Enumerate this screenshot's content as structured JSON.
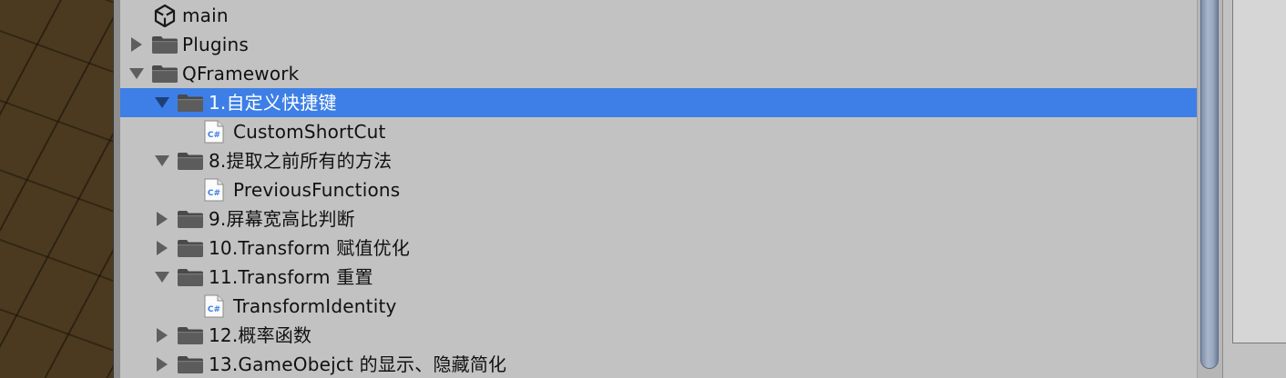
{
  "tree": {
    "items": [
      {
        "label": "main",
        "icon": "unity-scene-icon",
        "arrow": "none",
        "selected": false,
        "indent": 0
      },
      {
        "label": "Plugins",
        "icon": "folder-icon",
        "arrow": "collapsed",
        "selected": false,
        "indent": 0
      },
      {
        "label": "QFramework",
        "icon": "folder-icon",
        "arrow": "expanded",
        "selected": false,
        "indent": 0
      },
      {
        "label": "1.自定义快捷键",
        "icon": "folder-icon",
        "arrow": "expanded",
        "selected": true,
        "indent": 1
      },
      {
        "label": "CustomShortCut",
        "icon": "csharp-script-icon",
        "arrow": "none",
        "selected": false,
        "indent": 2
      },
      {
        "label": "8.提取之前所有的方法",
        "icon": "folder-icon",
        "arrow": "expanded",
        "selected": false,
        "indent": 1
      },
      {
        "label": "PreviousFunctions",
        "icon": "csharp-script-icon",
        "arrow": "none",
        "selected": false,
        "indent": 2
      },
      {
        "label": "9.屏幕宽高比判断",
        "icon": "folder-icon",
        "arrow": "collapsed",
        "selected": false,
        "indent": 1
      },
      {
        "label": "10.Transform 赋值优化",
        "icon": "folder-icon",
        "arrow": "collapsed",
        "selected": false,
        "indent": 1
      },
      {
        "label": "11.Transform 重置",
        "icon": "folder-icon",
        "arrow": "expanded",
        "selected": false,
        "indent": 1
      },
      {
        "label": "TransformIdentity",
        "icon": "csharp-script-icon",
        "arrow": "none",
        "selected": false,
        "indent": 2
      },
      {
        "label": "12.概率函数",
        "icon": "folder-icon",
        "arrow": "collapsed",
        "selected": false,
        "indent": 1
      },
      {
        "label": "13.GameObejct 的显示、隐藏简化",
        "icon": "folder-icon",
        "arrow": "collapsed",
        "selected": false,
        "indent": 1
      }
    ]
  },
  "colors": {
    "panel_bg": "#c2c2c2",
    "selection": "#3d7fe6",
    "folder": "#4a4a4a",
    "csharp_icon_text": "#3d7fe6"
  },
  "icons": {
    "csharp_glyph": "C#"
  }
}
